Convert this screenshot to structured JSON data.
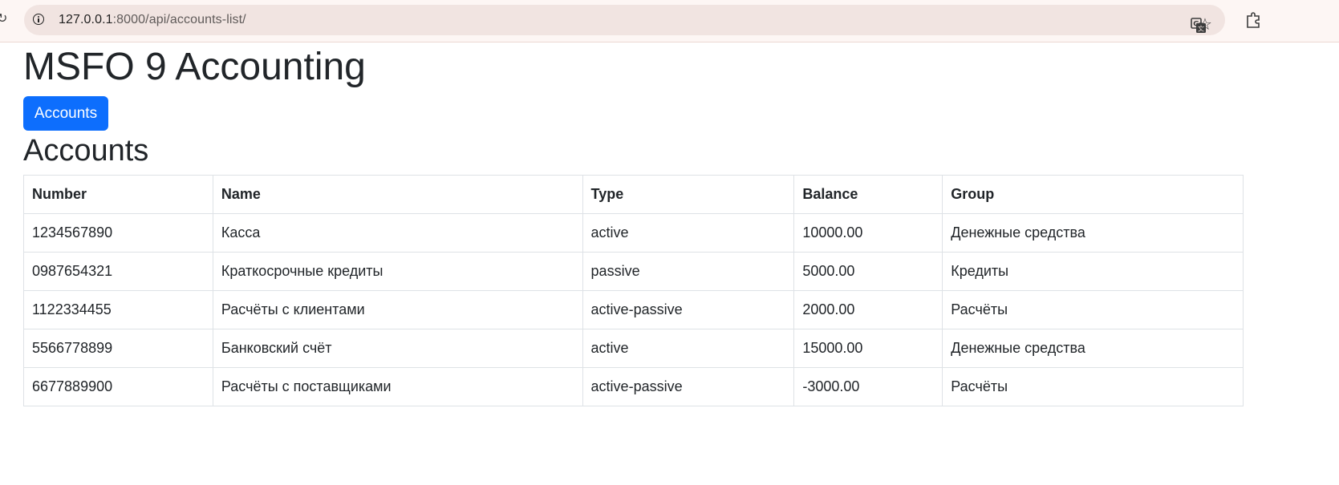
{
  "browser": {
    "url_host": "127.0.0.1",
    "url_path": ":8000/api/accounts-list/"
  },
  "page": {
    "title": "MSFO 9 Accounting",
    "nav_button_label": "Accounts",
    "section_title": "Accounts"
  },
  "table": {
    "columns": [
      "Number",
      "Name",
      "Type",
      "Balance",
      "Group"
    ],
    "rows": [
      {
        "number": "1234567890",
        "name": "Касса",
        "type": "active",
        "balance": "10000.00",
        "group": "Денежные средства"
      },
      {
        "number": "0987654321",
        "name": "Краткосрочные кредиты",
        "type": "passive",
        "balance": "5000.00",
        "group": "Кредиты"
      },
      {
        "number": "1122334455",
        "name": "Расчёты с клиентами",
        "type": "active-passive",
        "balance": "2000.00",
        "group": "Расчёты"
      },
      {
        "number": "5566778899",
        "name": "Банковский счёт",
        "type": "active",
        "balance": "15000.00",
        "group": "Денежные средства"
      },
      {
        "number": "6677889900",
        "name": "Расчёты с поставщиками",
        "type": "active-passive",
        "balance": "-3000.00",
        "group": "Расчёты"
      }
    ]
  },
  "colors": {
    "primary_button": "#0d6efd",
    "text": "#212529",
    "table_border": "#dee2e6"
  },
  "icons": [
    "reload-icon",
    "site-info-icon",
    "translate-icon",
    "bookmark-star-icon",
    "extensions-icon"
  ]
}
